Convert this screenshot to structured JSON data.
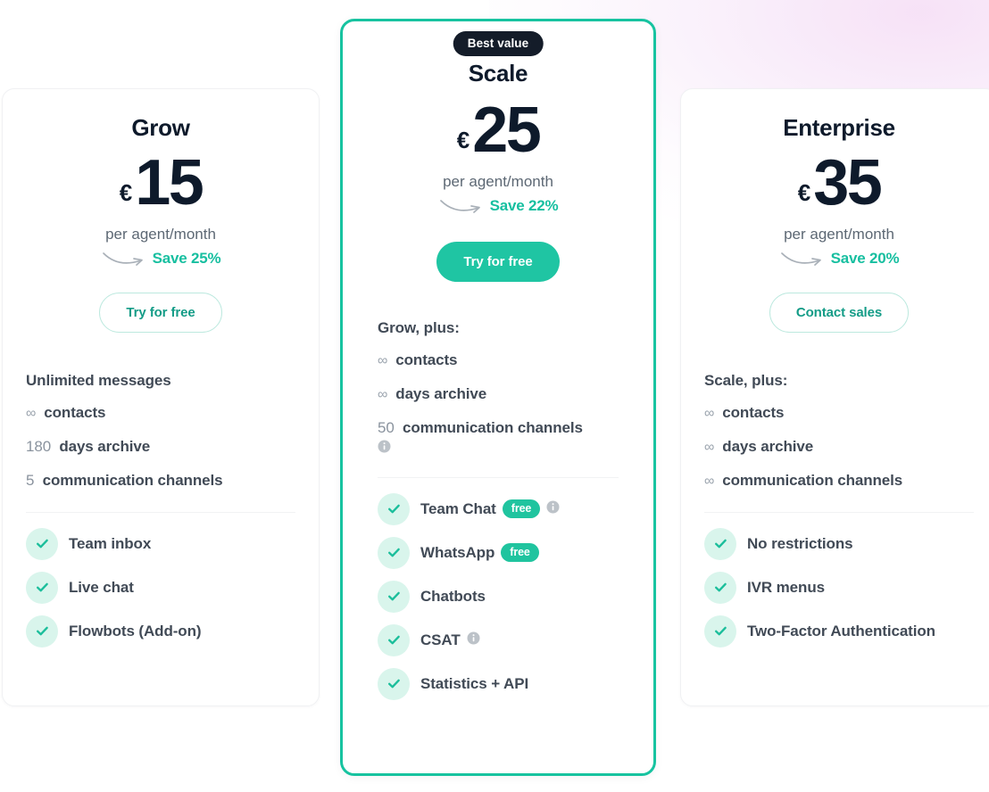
{
  "colors": {
    "accent_teal": "#1FC5A3",
    "accent_teal_dark": "#149C87",
    "badge_dark": "#141C29",
    "price_navy": "#0E1A2B",
    "body_slate": "#414A56",
    "muted_gray": "#8A939E",
    "check_bg_mint": "#D9F5EC",
    "card_border": "#F0F1F3"
  },
  "featured_badge": "Best value",
  "plans": [
    {
      "id": "grow",
      "name": "Grow",
      "currency": "€",
      "amount": "15",
      "per_unit": "per agent/month",
      "save_label": "Save 25%",
      "arrow_icon": "curved-arrow-right-icon",
      "cta_label": "Try for free",
      "cta_style": "outline",
      "feature_heading": "Unlimited messages",
      "quotas": [
        {
          "num": "∞",
          "num_is_infinity": true,
          "text": "contacts"
        },
        {
          "num": "180",
          "num_is_infinity": false,
          "text": "days archive"
        },
        {
          "num": "5",
          "num_is_infinity": false,
          "text": "communication channels"
        }
      ],
      "quota_info_icon": false,
      "checks": [
        {
          "label": "Team inbox",
          "free": false,
          "info": false
        },
        {
          "label": "Live chat",
          "free": false,
          "info": false
        },
        {
          "label": "Flowbots (Add-on)",
          "free": false,
          "info": false
        }
      ]
    },
    {
      "id": "scale",
      "name": "Scale",
      "currency": "€",
      "amount": "25",
      "per_unit": "per agent/month",
      "save_label": "Save 22%",
      "arrow_icon": "curved-arrow-right-icon",
      "cta_label": "Try for free",
      "cta_style": "solid",
      "feature_heading": "Grow, plus:",
      "quotas": [
        {
          "num": "∞",
          "num_is_infinity": true,
          "text": "contacts"
        },
        {
          "num": "∞",
          "num_is_infinity": true,
          "text": "days archive"
        },
        {
          "num": "50",
          "num_is_infinity": false,
          "text": "communication channels"
        }
      ],
      "quota_info_icon": true,
      "checks": [
        {
          "label": "Team Chat",
          "free": true,
          "free_label": "free",
          "info": true
        },
        {
          "label": "WhatsApp",
          "free": true,
          "free_label": "free",
          "info": false
        },
        {
          "label": "Chatbots",
          "free": false,
          "info": false
        },
        {
          "label": "CSAT",
          "free": false,
          "info": true
        },
        {
          "label": "Statistics + API",
          "free": false,
          "info": false
        }
      ]
    },
    {
      "id": "enterprise",
      "name": "Enterprise",
      "currency": "€",
      "amount": "35",
      "per_unit": "per agent/month",
      "save_label": "Save 20%",
      "arrow_icon": "curved-arrow-right-icon",
      "cta_label": "Contact sales",
      "cta_style": "outline",
      "feature_heading": "Scale, plus:",
      "quotas": [
        {
          "num": "∞",
          "num_is_infinity": true,
          "text": "contacts"
        },
        {
          "num": "∞",
          "num_is_infinity": true,
          "text": "days archive"
        },
        {
          "num": "∞",
          "num_is_infinity": true,
          "text": "communication channels"
        }
      ],
      "quota_info_icon": false,
      "checks": [
        {
          "label": "No restrictions",
          "free": false,
          "info": false
        },
        {
          "label": "IVR menus",
          "free": false,
          "info": false
        },
        {
          "label": "Two-Factor Authentication",
          "free": false,
          "info": false
        }
      ]
    }
  ]
}
